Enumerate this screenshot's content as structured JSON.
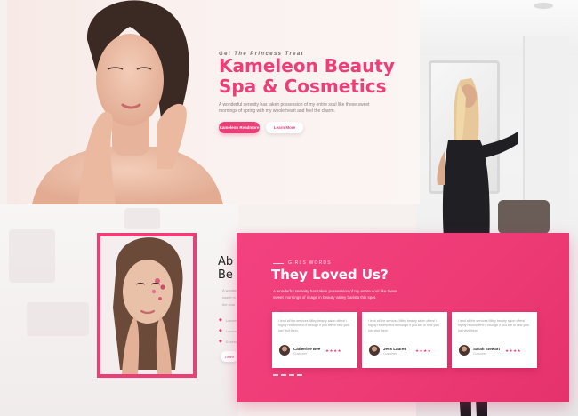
{
  "hero": {
    "kicker": "Get The Princess Treat",
    "title": "Kameleon Beauty Spa & Cosmetics",
    "description": "A wonderful serenity has taken possession of my entire soul like these sweet mornings of spring with my whole heart and feel the charm.",
    "primary_button": "Kameleon Readmore",
    "secondary_button": "Learn More"
  },
  "about": {
    "title_line1": "Ab",
    "title_line2": "Be",
    "text_lines": [
      "A wonder",
      "sweet m",
      "the char"
    ],
    "list": [
      "Lacom",
      "Lacom",
      "Excess"
    ],
    "button": "Learn"
  },
  "testimonials": {
    "kicker": "GIRLS WORDS",
    "heading": "They Loved Us?",
    "subtitle": "A wonderful serenity has taken possession of my entire soul like these sweet mornings of image in beauty valley barista this spot.",
    "cards": [
      {
        "quote": "I lend all the services Miley beauty salon offers! I highly recommend it enough if you are in new york just visit them.",
        "name": "Catherine Bee",
        "role": "Customer",
        "stars": "★★★★"
      },
      {
        "quote": "I lend all the services Miley beauty salon offers! I highly recommend it enough if you are in new york just visit them.",
        "name": "Jess Lauren",
        "role": "Customer",
        "stars": "★★★★"
      },
      {
        "quote": "I lend all the services Miley beauty salon offers! I highly recommend it enough if you are in new york just visit them.",
        "name": "Sarah Stewart",
        "role": "Customer",
        "stars": "★★★★"
      }
    ]
  },
  "colors": {
    "accent": "#ee3e78",
    "background": "#f6f1ef"
  }
}
